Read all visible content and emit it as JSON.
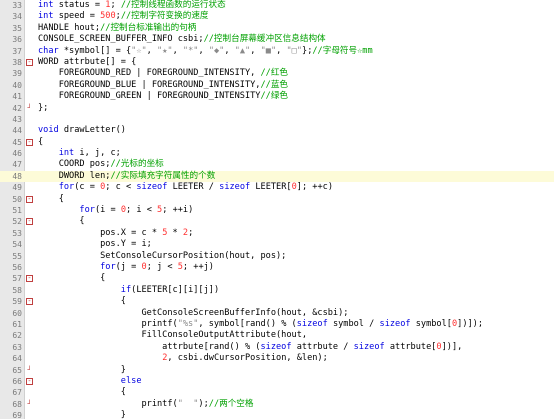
{
  "editor": {
    "first_line_number": 33,
    "active_line_index": 15,
    "lines": [
      [
        {
          "t": "int",
          "c": "kw"
        },
        {
          "t": " status = ",
          "c": "op"
        },
        {
          "t": "1",
          "c": "num"
        },
        {
          "t": "; ",
          "c": "op"
        },
        {
          "t": "//控制线程函数的运行状态",
          "c": "cm"
        }
      ],
      [
        {
          "t": "int",
          "c": "kw"
        },
        {
          "t": " speed = ",
          "c": "op"
        },
        {
          "t": "500",
          "c": "num"
        },
        {
          "t": ";",
          "c": "op"
        },
        {
          "t": "//控制字符变换的速度",
          "c": "cm"
        }
      ],
      [
        {
          "t": "HANDLE hout;",
          "c": "op"
        },
        {
          "t": "//控制台标准输出的句柄",
          "c": "cm"
        }
      ],
      [
        {
          "t": "CONSOLE_SCREEN_BUFFER_INFO csbi;",
          "c": "op"
        },
        {
          "t": "//控制台屏幕缓冲区信息结构体",
          "c": "cm"
        }
      ],
      [
        {
          "t": "char",
          "c": "kw"
        },
        {
          "t": " *symbol[] = {",
          "c": "op"
        },
        {
          "t": "\"☆\"",
          "c": "str"
        },
        {
          "t": ", ",
          "c": "op"
        },
        {
          "t": "\"★\"",
          "c": "str"
        },
        {
          "t": ", ",
          "c": "op"
        },
        {
          "t": "\"*\"",
          "c": "str"
        },
        {
          "t": ", ",
          "c": "op"
        },
        {
          "t": "\"◆\"",
          "c": "str"
        },
        {
          "t": ", ",
          "c": "op"
        },
        {
          "t": "\"▲\"",
          "c": "str"
        },
        {
          "t": ", ",
          "c": "op"
        },
        {
          "t": "\"■\"",
          "c": "str"
        },
        {
          "t": ", ",
          "c": "op"
        },
        {
          "t": "\"□\"",
          "c": "str"
        },
        {
          "t": "};",
          "c": "op"
        },
        {
          "t": "//字母符号☆mm",
          "c": "cm"
        }
      ],
      [
        {
          "t": "WORD attrbute[] = {",
          "c": "op"
        }
      ],
      [
        {
          "t": "    FOREGROUND_RED | FOREGROUND_INTENSITY, ",
          "c": "op"
        },
        {
          "t": "//红色",
          "c": "cm"
        }
      ],
      [
        {
          "t": "    FOREGROUND_BLUE | FOREGROUND_INTENSITY,",
          "c": "op"
        },
        {
          "t": "//蓝色",
          "c": "cm"
        }
      ],
      [
        {
          "t": "    FOREGROUND_GREEN | FOREGROUND_INTENSITY",
          "c": "op"
        },
        {
          "t": "//绿色",
          "c": "cm"
        }
      ],
      [
        {
          "t": "};",
          "c": "op"
        }
      ],
      [],
      [
        {
          "t": "void",
          "c": "kw"
        },
        {
          "t": " drawLetter()",
          "c": "op"
        }
      ],
      [
        {
          "t": "{",
          "c": "op"
        }
      ],
      [
        {
          "t": "    ",
          "c": "op"
        },
        {
          "t": "int",
          "c": "kw"
        },
        {
          "t": " i, j, c;",
          "c": "op"
        }
      ],
      [
        {
          "t": "    COORD pos;",
          "c": "op"
        },
        {
          "t": "//光标的坐标",
          "c": "cm"
        }
      ],
      [
        {
          "t": "    DWORD len;",
          "c": "op"
        },
        {
          "t": "//实际填充字符属性的个数",
          "c": "cm"
        }
      ],
      [
        {
          "t": "    ",
          "c": "op"
        },
        {
          "t": "for",
          "c": "kw"
        },
        {
          "t": "(c = ",
          "c": "op"
        },
        {
          "t": "0",
          "c": "num"
        },
        {
          "t": "; c < ",
          "c": "op"
        },
        {
          "t": "sizeof",
          "c": "kw"
        },
        {
          "t": " LEETER / ",
          "c": "op"
        },
        {
          "t": "sizeof",
          "c": "kw"
        },
        {
          "t": " LEETER[",
          "c": "op"
        },
        {
          "t": "0",
          "c": "num"
        },
        {
          "t": "]; ++c)",
          "c": "op"
        }
      ],
      [
        {
          "t": "    {",
          "c": "op"
        }
      ],
      [
        {
          "t": "        ",
          "c": "op"
        },
        {
          "t": "for",
          "c": "kw"
        },
        {
          "t": "(i = ",
          "c": "op"
        },
        {
          "t": "0",
          "c": "num"
        },
        {
          "t": "; i < ",
          "c": "op"
        },
        {
          "t": "5",
          "c": "num"
        },
        {
          "t": "; ++i)",
          "c": "op"
        }
      ],
      [
        {
          "t": "        {",
          "c": "op"
        }
      ],
      [
        {
          "t": "            pos.X = c * ",
          "c": "op"
        },
        {
          "t": "5",
          "c": "num"
        },
        {
          "t": " * ",
          "c": "op"
        },
        {
          "t": "2",
          "c": "num"
        },
        {
          "t": ";",
          "c": "op"
        }
      ],
      [
        {
          "t": "            pos.Y = i;",
          "c": "op"
        }
      ],
      [
        {
          "t": "            SetConsoleCursorPosition(hout, pos);",
          "c": "op"
        }
      ],
      [
        {
          "t": "            ",
          "c": "op"
        },
        {
          "t": "for",
          "c": "kw"
        },
        {
          "t": "(j = ",
          "c": "op"
        },
        {
          "t": "0",
          "c": "num"
        },
        {
          "t": "; j < ",
          "c": "op"
        },
        {
          "t": "5",
          "c": "num"
        },
        {
          "t": "; ++j)",
          "c": "op"
        }
      ],
      [
        {
          "t": "            {",
          "c": "op"
        }
      ],
      [
        {
          "t": "                ",
          "c": "op"
        },
        {
          "t": "if",
          "c": "kw"
        },
        {
          "t": "(LEETER[c][i][j])",
          "c": "op"
        }
      ],
      [
        {
          "t": "                {",
          "c": "op"
        }
      ],
      [
        {
          "t": "                    GetConsoleScreenBufferInfo(hout, &csbi);",
          "c": "op"
        }
      ],
      [
        {
          "t": "                    printf(",
          "c": "op"
        },
        {
          "t": "\"%s\"",
          "c": "str"
        },
        {
          "t": ", symbol[rand() % (",
          "c": "op"
        },
        {
          "t": "sizeof",
          "c": "kw"
        },
        {
          "t": " symbol / ",
          "c": "op"
        },
        {
          "t": "sizeof",
          "c": "kw"
        },
        {
          "t": " symbol[",
          "c": "op"
        },
        {
          "t": "0",
          "c": "num"
        },
        {
          "t": "])]);",
          "c": "op"
        }
      ],
      [
        {
          "t": "                    FillConsoleOutputAttribute(hout,",
          "c": "op"
        }
      ],
      [
        {
          "t": "                        attrbute[rand() % (",
          "c": "op"
        },
        {
          "t": "sizeof",
          "c": "kw"
        },
        {
          "t": " attrbute / ",
          "c": "op"
        },
        {
          "t": "sizeof",
          "c": "kw"
        },
        {
          "t": " attrbute[",
          "c": "op"
        },
        {
          "t": "0",
          "c": "num"
        },
        {
          "t": "])],",
          "c": "op"
        }
      ],
      [
        {
          "t": "                        ",
          "c": "op"
        },
        {
          "t": "2",
          "c": "num"
        },
        {
          "t": ", csbi.dwCursorPosition, &len);",
          "c": "op"
        }
      ],
      [
        {
          "t": "                }",
          "c": "op"
        }
      ],
      [
        {
          "t": "                ",
          "c": "op"
        },
        {
          "t": "else",
          "c": "kw"
        }
      ],
      [
        {
          "t": "                {",
          "c": "op"
        }
      ],
      [
        {
          "t": "                    printf(",
          "c": "op"
        },
        {
          "t": "\"  \"",
          "c": "str"
        },
        {
          "t": ");",
          "c": "op"
        },
        {
          "t": "//两个空格",
          "c": "cm"
        }
      ],
      [
        {
          "t": "                }",
          "c": "op"
        }
      ]
    ],
    "fold_marks": {
      "38": "box-minus",
      "42": "end",
      "45": "box-minus",
      "50": "box-minus",
      "52": "box-minus",
      "57": "box-minus",
      "59": "box-minus",
      "65": "end",
      "66": "box-minus",
      "68": "end"
    }
  }
}
